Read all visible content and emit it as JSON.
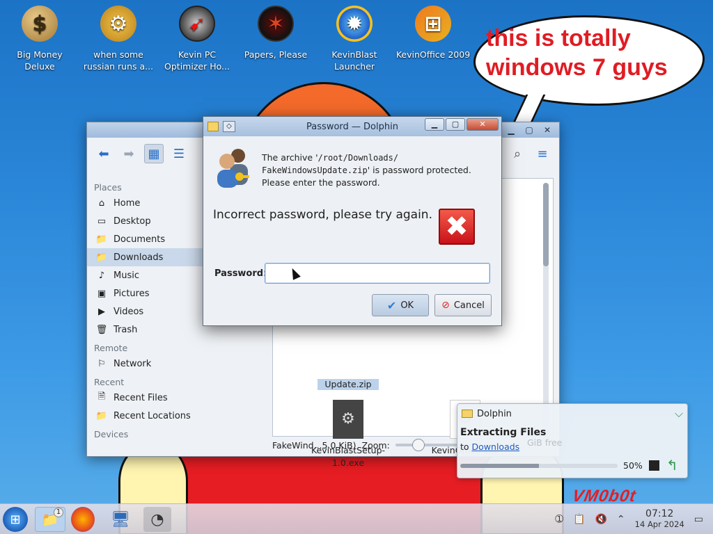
{
  "desktop": {
    "speech_bubble": "this is totally windows 7 guys",
    "watermark": "VM0b0t",
    "icons": [
      {
        "label": "Big Money Deluxe",
        "icon": "money-bag-icon"
      },
      {
        "label": "when some russian runs a...",
        "icon": "gear-icon"
      },
      {
        "label": "Kevin PC Optimizer Ho...",
        "icon": "gauge-icon"
      },
      {
        "label": "Papers, Please",
        "icon": "papers-icon"
      },
      {
        "label": "KevinBlast Launcher",
        "icon": "blast-icon"
      },
      {
        "label": "KevinOffice 2009",
        "icon": "office-icon"
      }
    ]
  },
  "dolphin": {
    "places": {
      "heading": "Places",
      "items": [
        "Home",
        "Desktop",
        "Documents",
        "Downloads",
        "Music",
        "Pictures",
        "Videos",
        "Trash"
      ]
    },
    "remote": {
      "heading": "Remote",
      "items": [
        "Network"
      ]
    },
    "recent": {
      "heading": "Recent",
      "items": [
        "Recent Files",
        "Recent Locations"
      ]
    },
    "devices": {
      "heading": "Devices"
    },
    "files": {
      "selected_partial": "Update.zip",
      "kevinblast": "KevinBlastSetup-1.0.exe",
      "kevinoffice": "KevinOffice.exe"
    },
    "status": {
      "text": "FakeWind...5.0 KiB)",
      "zoom_label": "Zoom:",
      "free_space": "GiB free",
      "zoom_percent": 25
    }
  },
  "dialog": {
    "title": "Password — Dolphin",
    "message_prefix": "The archive '",
    "message_path": "/root/Downloads/ FakeWindowsUpdate.zip",
    "message_suffix": "' is password protected. Please enter the password.",
    "error": "Incorrect password, please try again.",
    "password_label": "Password:",
    "password_value": "",
    "ok": "OK",
    "cancel": "Cancel"
  },
  "notification": {
    "app": "Dolphin",
    "title": "Extracting Files",
    "sub_prefix": "to ",
    "sub_link": "Downloads",
    "progress_label": "50%",
    "progress_value": 0.5
  },
  "taskbar": {
    "time": "07:12",
    "date": "14 Apr 2024",
    "files_badge": "1"
  }
}
